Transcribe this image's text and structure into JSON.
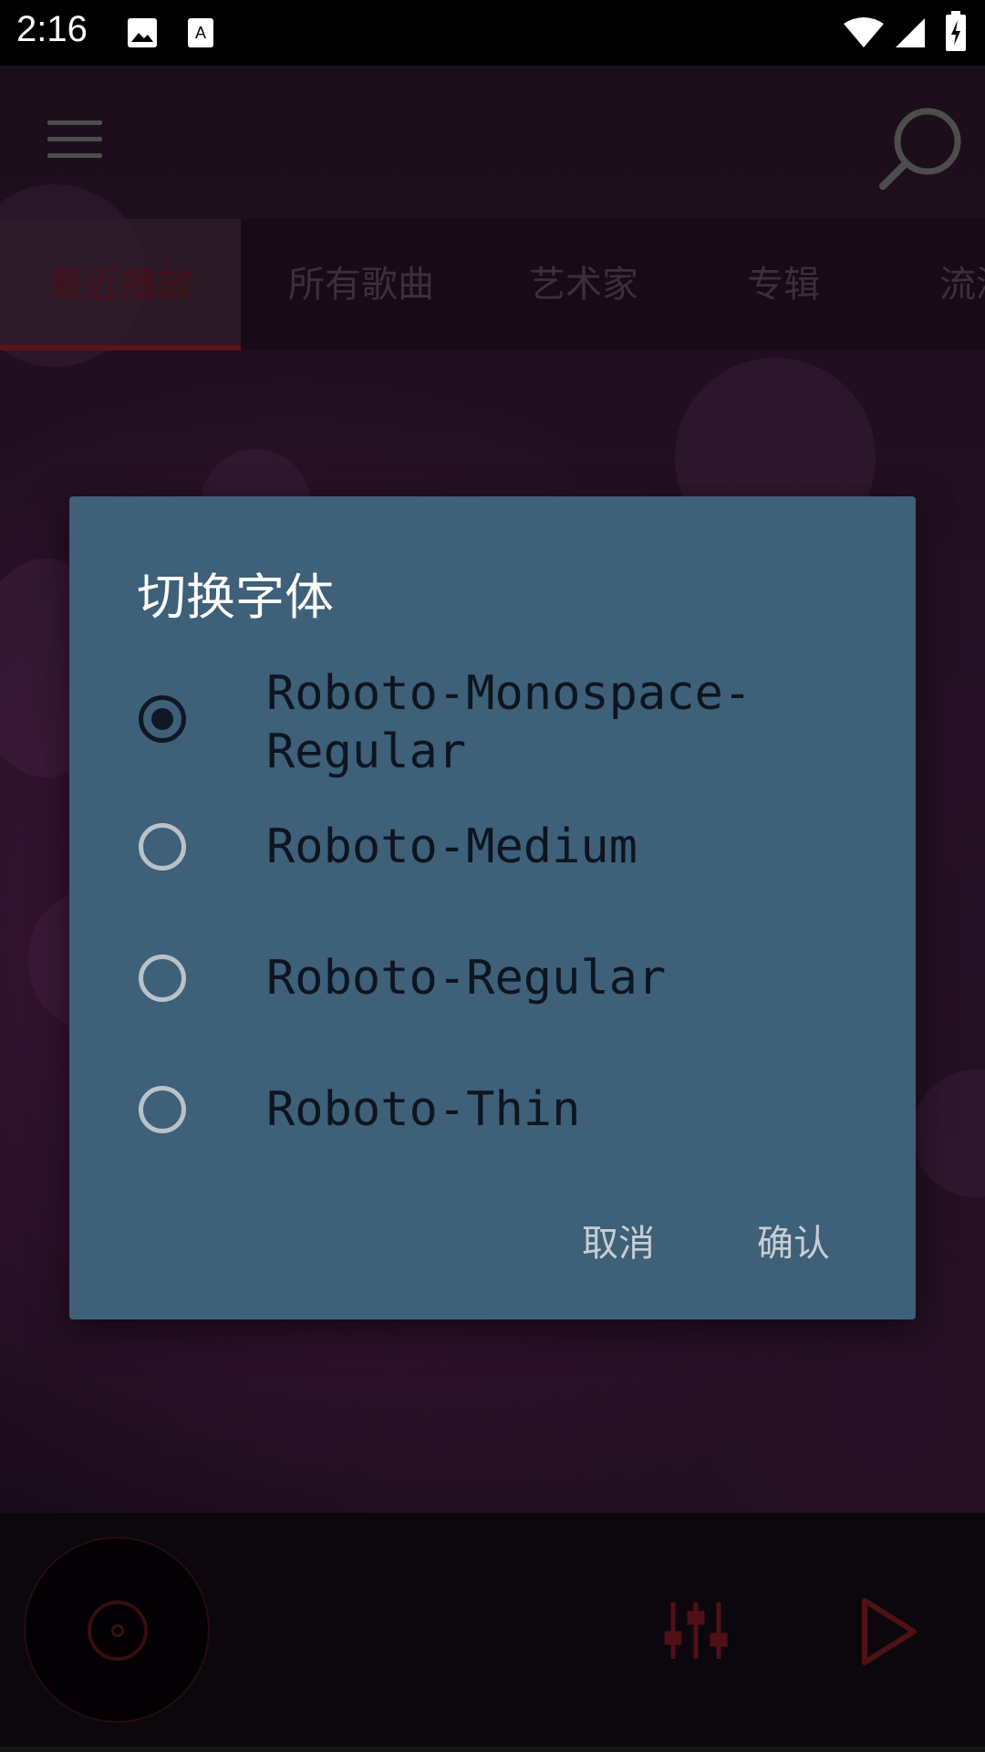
{
  "status_bar": {
    "time": "2:16"
  },
  "tabs": [
    {
      "label": "最近播放",
      "active": true
    },
    {
      "label": "所有歌曲",
      "active": false
    },
    {
      "label": "艺术家",
      "active": false
    },
    {
      "label": "专辑",
      "active": false
    },
    {
      "label": "流派",
      "active": false
    }
  ],
  "dialog": {
    "title": "切换字体",
    "options": [
      {
        "label": "Roboto-Monospace-\nRegular",
        "selected": true
      },
      {
        "label": "Roboto-Medium",
        "selected": false
      },
      {
        "label": "Roboto-Regular",
        "selected": false
      },
      {
        "label": "Roboto-Thin",
        "selected": false
      }
    ],
    "cancel_label": "取消",
    "confirm_label": "确认"
  },
  "colors": {
    "dialog_bg": "#3e6079",
    "accent_red": "#8a1f2a"
  }
}
